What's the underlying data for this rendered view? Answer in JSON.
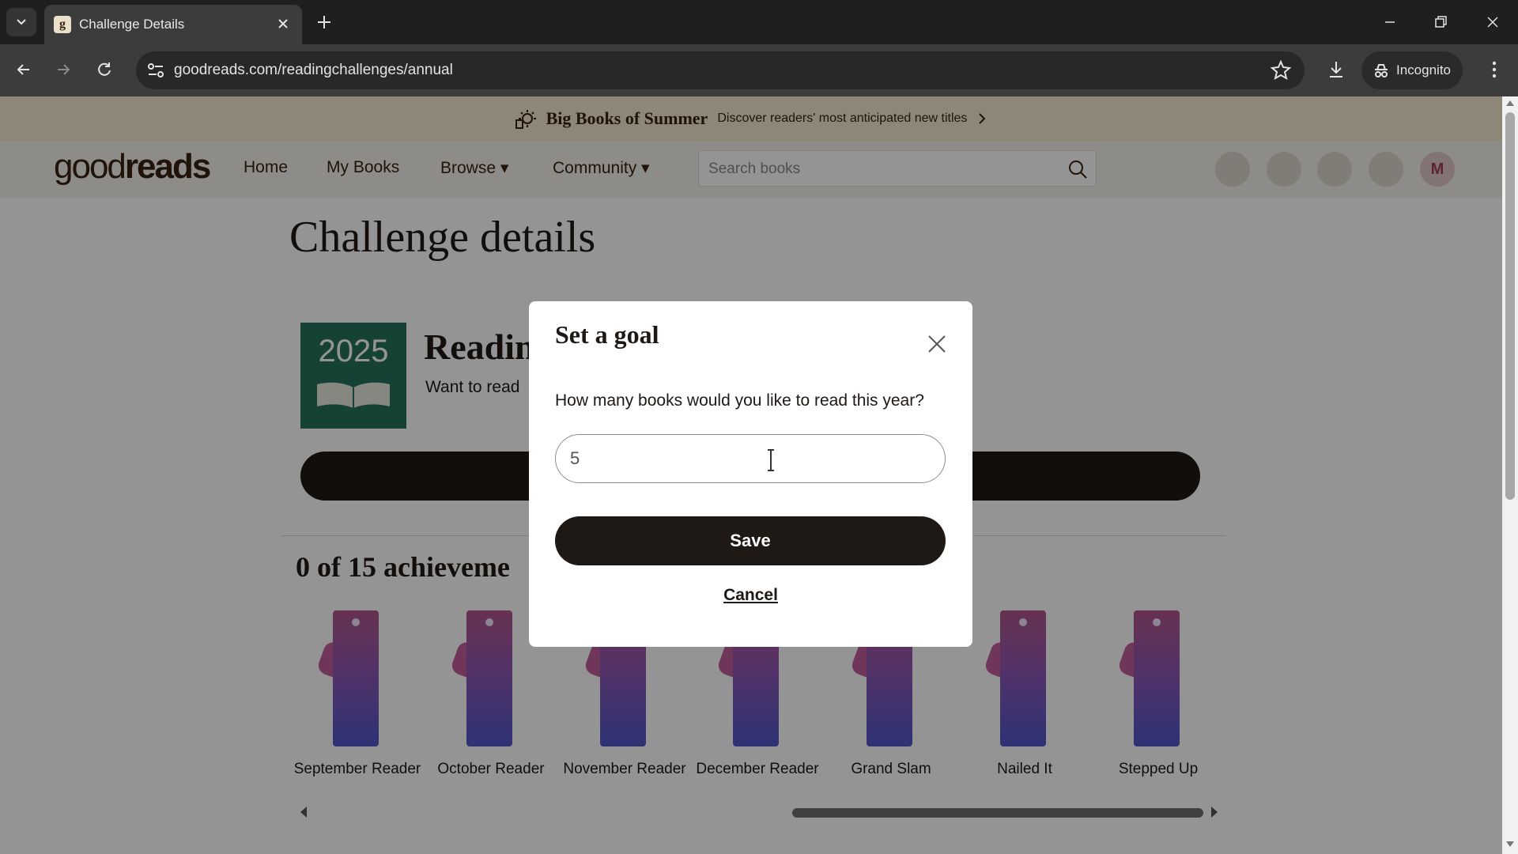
{
  "browser": {
    "tab_title": "Challenge Details",
    "favicon_letter": "g",
    "url": "goodreads.com/readingchallenges/annual",
    "incognito_label": "Incognito"
  },
  "banner": {
    "title": "Big Books of Summer",
    "subtitle": "Discover readers' most anticipated new titles"
  },
  "header": {
    "logo_light": "good",
    "logo_bold": "reads",
    "nav": {
      "home": "Home",
      "my_books": "My Books",
      "browse": "Browse ▾",
      "community": "Community ▾"
    },
    "search_placeholder": "Search books",
    "avatar_letter": "M"
  },
  "page": {
    "title": "Challenge details",
    "badge_year": "2025",
    "reading_title": "Readin",
    "reading_sub": "Want to read",
    "achievements_title": "0 of 15 achieveme",
    "achievements": [
      "September Reader",
      "October Reader",
      "November Reader",
      "December Reader",
      "Grand Slam",
      "Nailed It",
      "Stepped Up"
    ]
  },
  "modal": {
    "title": "Set a goal",
    "question": "How many books would you like to read this year?",
    "input_value": "5",
    "save_label": "Save",
    "cancel_label": "Cancel"
  },
  "colors": {
    "banner_bg": "#f4e7cd",
    "header_bg": "#f4f1ea",
    "brand_dark": "#382110",
    "badge_green": "#27735e",
    "button_dark": "#1e1915"
  }
}
